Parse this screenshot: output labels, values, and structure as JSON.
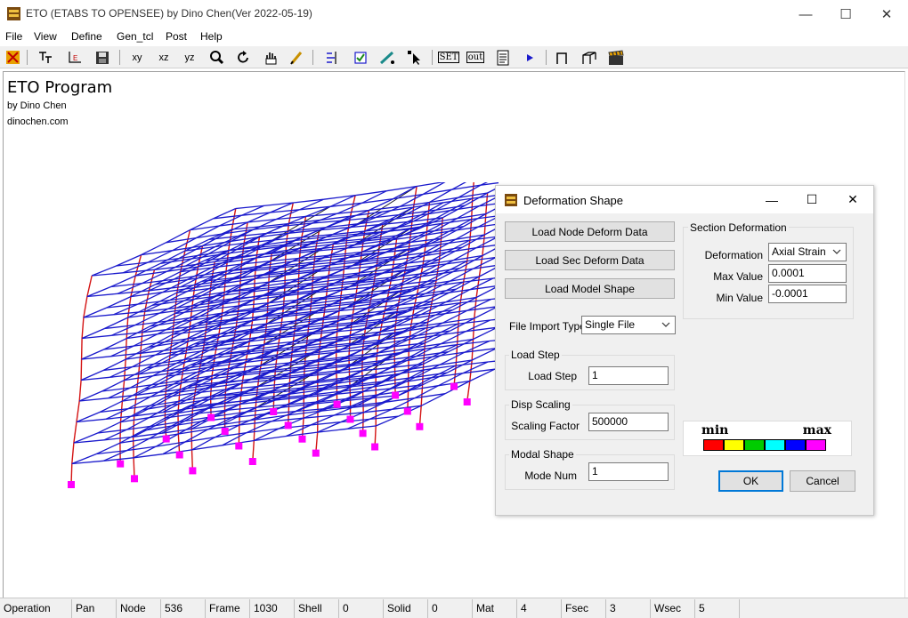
{
  "window": {
    "title": "ETO (ETABS TO OPENSEE) by Dino Chen(Ver 2022-05-19)",
    "minimize_glyph": "—",
    "maximize_glyph": "☐",
    "close_glyph": "✕"
  },
  "menu": [
    "File",
    "View",
    "Define",
    "Gen_tcl",
    "Post",
    "Help"
  ],
  "toolbar": {
    "view_xy": "xy",
    "view_xz": "xz",
    "view_yz": "yz",
    "set_label": "SET",
    "out_label": "out",
    "icons": [
      "eto-logo-icon",
      "text-axis-icon",
      "axis-icon",
      "save-icon",
      "zoom-icon",
      "rotate-icon",
      "pan-hand-icon",
      "pencil-icon",
      "node-icon",
      "checkbox-icon",
      "line-tool-icon",
      "select-cursor-icon",
      "document-icon",
      "play-icon",
      "frame-icon",
      "frame-3d-icon",
      "clapper-icon"
    ]
  },
  "canvas": {
    "program_title": "ETO Program",
    "author": "by Dino Chen",
    "website": "dinochen.com",
    "colors": {
      "beam": "#1a1acc",
      "column": "#d41414",
      "brace": "#1a1a2a",
      "support": "#ff00ff"
    }
  },
  "dialog": {
    "title": "Deformation Shape",
    "load_node_button": "Load Node Deform Data",
    "load_sec_button": "Load Sec Deform Data",
    "load_model_button": "Load Model Shape",
    "file_import_label": "File Import Type",
    "file_import_value": "Single File",
    "section_group_title": "Section Deformation",
    "deformation_label": "Deformation",
    "deformation_value": "Axial Strain",
    "max_label": "Max Value",
    "max_value": "0.0001",
    "min_label": "Min Value",
    "min_value": "-0.0001",
    "load_step_group": "Load Step",
    "load_step_label": "Load Step",
    "load_step_value": "1",
    "disp_group": "Disp Scaling",
    "scaling_label": "Scaling Factor",
    "scaling_value": "500000",
    "modal_group": "Modal Shape",
    "mode_label": "Mode Num",
    "mode_value": "1",
    "legend_min": "min",
    "legend_max": "max",
    "legend_colors": [
      "#ff0000",
      "#ffff00",
      "#00cc00",
      "#00ffff",
      "#0000ff",
      "#ff00ff"
    ],
    "ok_button": "OK",
    "cancel_button": "Cancel"
  },
  "status": [
    {
      "label": "Operation",
      "value": "Pan"
    },
    {
      "label": "Node",
      "value": "536"
    },
    {
      "label": "Frame",
      "value": "1030"
    },
    {
      "label": "Shell",
      "value": "0"
    },
    {
      "label": "Solid",
      "value": "0"
    },
    {
      "label": "Mat",
      "value": "4"
    },
    {
      "label": "Fsec",
      "value": "3"
    },
    {
      "label": "Wsec",
      "value": "5"
    }
  ]
}
